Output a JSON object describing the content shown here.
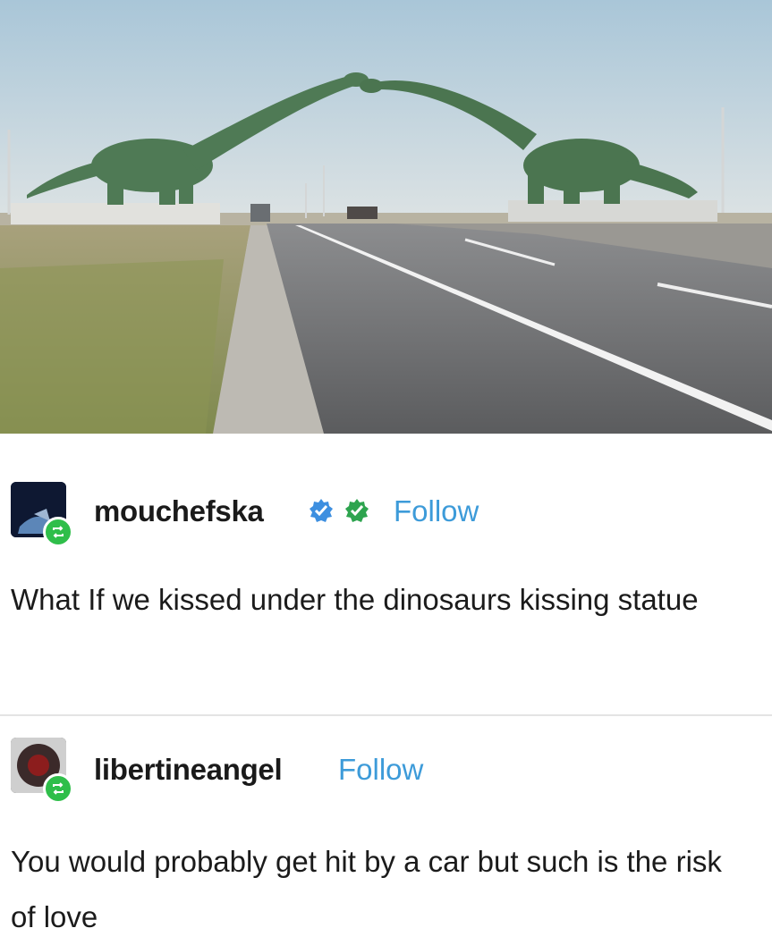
{
  "image": {
    "alt": "Two dinosaur statues kissing over a highway"
  },
  "posts": [
    {
      "username": "mouchefska",
      "follow_label": "Follow",
      "verified_badge_colors": [
        "#3d8fe0",
        "#2ea44f"
      ],
      "text": "What If we kissed under the dinosaurs kissing statue"
    },
    {
      "username": "libertineangel",
      "follow_label": "Follow",
      "text": "You would probably get hit by a car but such is the risk of love"
    }
  ],
  "colors": {
    "follow": "#3d9bd9",
    "reblog_badge": "#2fbe4a",
    "divider": "#e4e4e4"
  }
}
